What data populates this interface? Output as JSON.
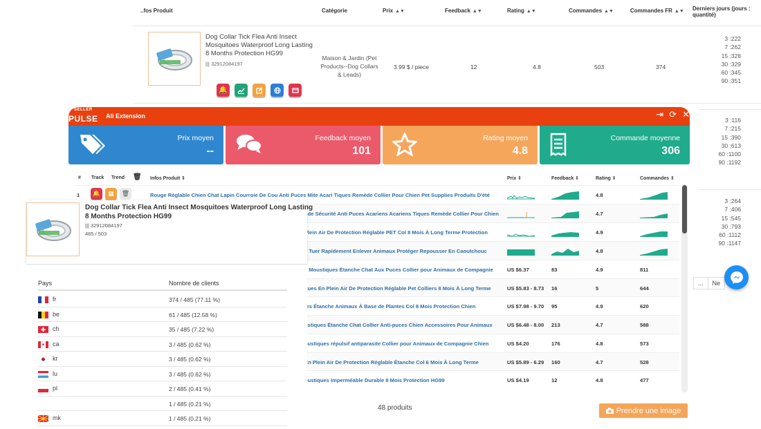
{
  "bg": {
    "headers": {
      "product": "..fos Produit",
      "category": "Catégorie",
      "price": "Prix",
      "feedback": "Feedback",
      "rating": "Rating",
      "orders": "Commandes",
      "orders_fr": "Commandes FR",
      "last_days": "Derniers jours (jours : quantité)"
    },
    "row": {
      "title": "Dog Collar Tick Flea Anti Insect Mosquitoes Waterproof Long Lasting 8 Months Protection HG99",
      "id": "32912084197",
      "category": "Maison & Jardin (Pet Products--Dog Collars & Leads)",
      "price": "3.99 $ / piece",
      "feedback": "12",
      "rating": "4.8",
      "orders": "503",
      "orders_fr": "374"
    },
    "days_1": [
      "3 :222",
      "7 :262",
      "15 :328",
      "30 :329",
      "60 :345",
      "90 :351"
    ],
    "days_2": [
      "3 :116",
      "7 :215",
      "15 :390",
      "30 :613",
      "60 :1100",
      "90 :1192"
    ],
    "days_3": [
      "3 :264",
      "7 :406",
      "15 :545",
      "30 :793",
      "60 :1112",
      "90 :1147"
    ],
    "pager": [
      "...",
      "Ne"
    ]
  },
  "ext": {
    "logo_small": "SELLER",
    "logo_big": "PULSE",
    "name": "Ali Extension",
    "stats": [
      {
        "label": "Prix moyen",
        "value": "--",
        "color": "#2f87cf"
      },
      {
        "label": "Feedback moyen",
        "value": "101",
        "color": "#ea5a6b"
      },
      {
        "label": "Rating moyen",
        "value": "4.8",
        "color": "#f5a65b"
      },
      {
        "label": "Commande moyenne",
        "value": "306",
        "color": "#1fab8c"
      }
    ],
    "list_headers": {
      "num": "#",
      "track": "Track",
      "trend": "Trend",
      "info": "Infos Produit",
      "price": "Prix",
      "feedback": "Feedback",
      "rating": "Rating",
      "orders": "Commandes"
    },
    "rows": [
      {
        "num": "1",
        "title": "Rouge Réglable Chien Chat Lapin Courroie De Cou Anti Puces Mite Acari Tiques Remède Collier Pour Chien Pet Supplies Produits D'été",
        "price": "",
        "feedback": "",
        "rating": "4.8",
        "orders": ""
      },
      {
        "num": "",
        "title": "- de Sécurité Anti Puces Acariens Acariens Tiques Remède Collier Pour Chien",
        "price": "",
        "feedback": "",
        "rating": "4.7",
        "orders": ""
      },
      {
        "num": "",
        "title": "Plein Air De Protection Réglable PET Col 8 Mois À Long Terme Protection",
        "price": "",
        "feedback": "",
        "rating": "4.9",
        "orders": ""
      },
      {
        "num": "",
        "title": "s Tuer Rapidement Enlever Animaux Protéger Repousser En Caoutchouc",
        "price": "",
        "feedback": "",
        "rating": "4.8",
        "orders": ""
      },
      {
        "num": "",
        "title": "s Moustiques Étanche Chat Aux Puces Collier pour Animaux de Compagnie",
        "price": "US $6.37",
        "feedback": "83",
        "rating": "4.9",
        "orders": "811"
      },
      {
        "num": "",
        "title": "ques En Plein Air De Protection Réglable Pet Colliers 8 Mois À Long Terme",
        "price": "US $5.83 - 8.73",
        "feedback": "16",
        "rating": "5",
        "orders": "644"
      },
      {
        "num": "",
        "title": "tes Étanche Animaux À Base de Plantes Col 8 Mois Protection Chien",
        "price": "US $7.98 - 9.70",
        "feedback": "95",
        "rating": "4.9",
        "orders": "620"
      },
      {
        "num": "",
        "title": "ustiques Étanche Chat Collier Anti-puces Chien Accessoires Pour Animaux",
        "price": "US $6.48 - 8.00",
        "feedback": "213",
        "rating": "4.7",
        "orders": "588"
      },
      {
        "num": "",
        "title": "oustiques répulsif antiparasite Collier pour Animaux de Compagnie Chien",
        "price": "US $4.20",
        "feedback": "176",
        "rating": "4.8",
        "orders": "573"
      },
      {
        "num": "",
        "title": "En Plein Air De Protection Réglable Étanche Col 6 Mois À Long Terme",
        "price": "US $5.89 - 6.29",
        "feedback": "160",
        "rating": "4.7",
        "orders": "528"
      },
      {
        "num": "",
        "title": "oustiques Imperméable Durable 8 Mois Protection HG99",
        "price": "US $4.19",
        "feedback": "12",
        "rating": "4.8",
        "orders": "477"
      }
    ],
    "footer_count": "48 produits",
    "capture_label": "Prendre une image"
  },
  "popover": {
    "title": "Dog Collar Tick Flea Anti Insect Mosquitoes Waterproof Long Lasting 8 Months Protection HG99",
    "id": "32912084197",
    "ratio": "485 / 503"
  },
  "countries": {
    "head_country": "Pays",
    "head_clients": "Nombre de clients",
    "rows": [
      {
        "code": "fr",
        "count": "374 / 485 (77.11 %)"
      },
      {
        "code": "be",
        "count": "61 / 485 (12.58 %)"
      },
      {
        "code": "ch",
        "count": "35 / 485 (7.22 %)"
      },
      {
        "code": "ca",
        "count": "3 / 485 (0.62 %)"
      },
      {
        "code": "kr",
        "count": "3 / 485 (0.62 %)"
      },
      {
        "code": "lu",
        "count": "3 / 485 (0.62 %)"
      },
      {
        "code": "pl",
        "count": "2 / 485 (0.41 %)"
      },
      {
        "code": "",
        "count": "1 / 485 (0.21 %)"
      },
      {
        "code": "mk",
        "count": "1 / 485 (0.21 %)"
      }
    ]
  }
}
